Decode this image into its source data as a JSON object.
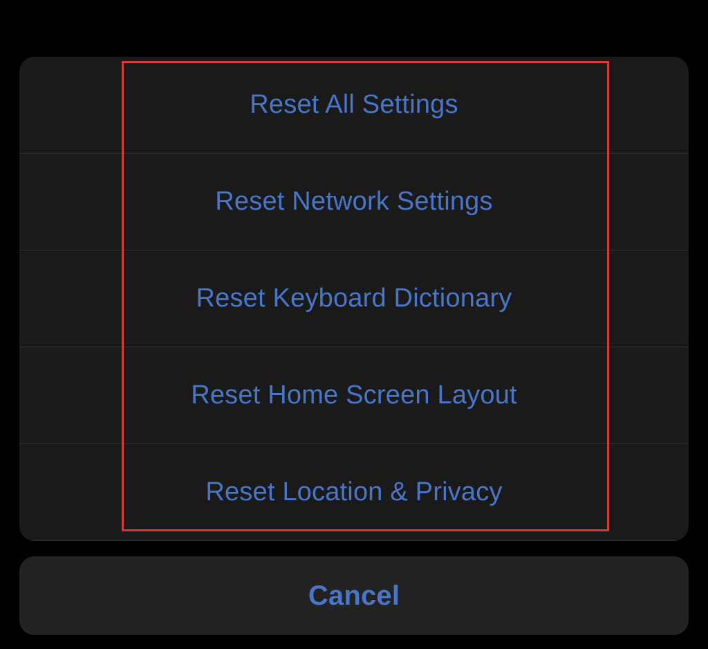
{
  "actionSheet": {
    "options": [
      {
        "label": "Reset All Settings"
      },
      {
        "label": "Reset Network Settings"
      },
      {
        "label": "Reset Keyboard Dictionary"
      },
      {
        "label": "Reset Home Screen Layout"
      },
      {
        "label": "Reset Location & Privacy"
      }
    ],
    "cancel": "Cancel"
  }
}
